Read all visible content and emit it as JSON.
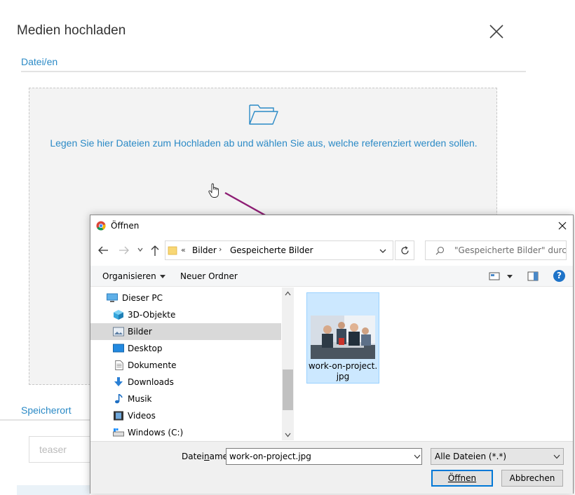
{
  "upload_dialog": {
    "title": "Medien hochladen",
    "files_tab": "Datei/en",
    "drop_text": "Legen Sie hier Dateien zum Hochladen ab und wählen Sie aus, welche referenziert werden sollen.",
    "location_tab": "Speicherort",
    "location_placeholder": "teaser",
    "accent_color": "#2b8ac6"
  },
  "file_dialog": {
    "title": "Öffnen",
    "address": {
      "prefix": "«",
      "crumbs": [
        "Bilder",
        "Gespeicherte Bilder"
      ],
      "separator": "›"
    },
    "search_placeholder": "\"Gespeicherte Bilder\" durchsuchen",
    "toolbar": {
      "organize": "Organisieren",
      "new_folder": "Neuer Ordner",
      "help": "?"
    },
    "tree": [
      {
        "label": "Dieser PC",
        "icon": "pc-icon"
      },
      {
        "label": "3D-Objekte",
        "icon": "3d-objects-icon"
      },
      {
        "label": "Bilder",
        "icon": "pictures-icon",
        "selected": true
      },
      {
        "label": "Desktop",
        "icon": "desktop-icon"
      },
      {
        "label": "Dokumente",
        "icon": "documents-icon"
      },
      {
        "label": "Downloads",
        "icon": "downloads-icon"
      },
      {
        "label": "Musik",
        "icon": "music-icon"
      },
      {
        "label": "Videos",
        "icon": "videos-icon"
      },
      {
        "label": "Windows (C:)",
        "icon": "drive-icon"
      }
    ],
    "file": {
      "name_line1": "work-on-project.",
      "name_line2": "jpg"
    },
    "filename_label_pre": "Datei",
    "filename_label_underlined": "n",
    "filename_label_post": "ame:",
    "filename_value": "work-on-project.jpg",
    "file_type": "Alle Dateien (*.*)",
    "open_button": "Öffnen",
    "cancel_button": "Abbrechen"
  }
}
